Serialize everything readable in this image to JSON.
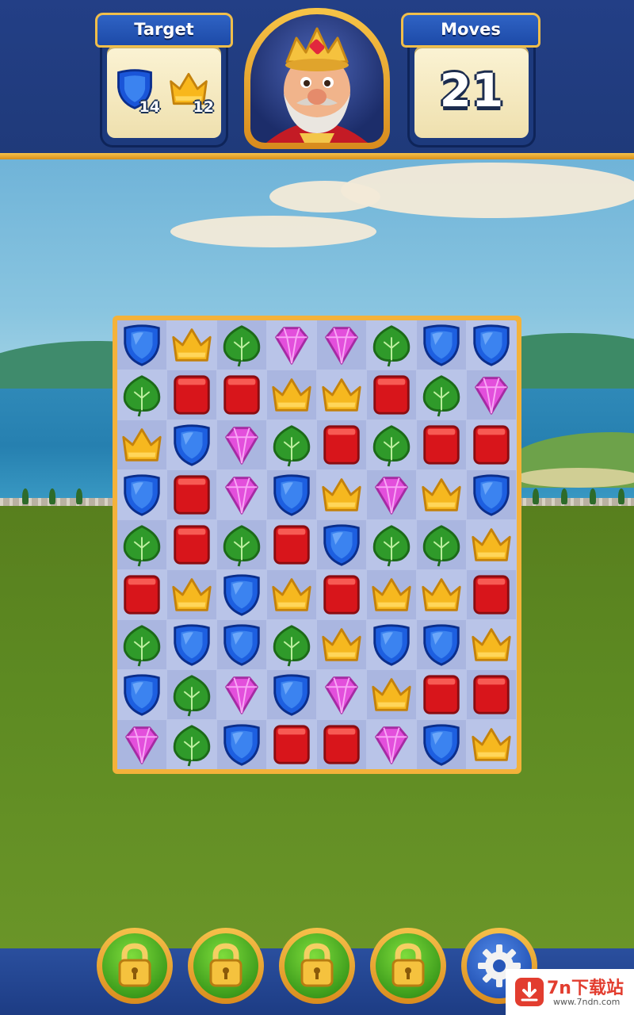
{
  "header": {
    "target_label": "Target",
    "moves_label": "Moves",
    "moves_value": "21",
    "targets": [
      {
        "piece": "shield",
        "count": "14"
      },
      {
        "piece": "crown",
        "count": "12"
      }
    ]
  },
  "board": {
    "rows": 9,
    "cols": 8,
    "grid": [
      [
        "shield",
        "crown",
        "leaf",
        "gem",
        "gem",
        "leaf",
        "shield",
        "shield"
      ],
      [
        "leaf",
        "box",
        "box",
        "crown",
        "crown",
        "box",
        "leaf",
        "gem"
      ],
      [
        "crown",
        "shield",
        "gem",
        "leaf",
        "box",
        "leaf",
        "box",
        "box"
      ],
      [
        "shield",
        "box",
        "gem",
        "shield",
        "crown",
        "gem",
        "crown",
        "shield"
      ],
      [
        "leaf",
        "box",
        "leaf",
        "box",
        "shield",
        "leaf",
        "leaf",
        "crown"
      ],
      [
        "box",
        "crown",
        "shield",
        "crown",
        "box",
        "crown",
        "crown",
        "box"
      ],
      [
        "leaf",
        "shield",
        "shield",
        "leaf",
        "crown",
        "shield",
        "shield",
        "crown"
      ],
      [
        "shield",
        "leaf",
        "gem",
        "shield",
        "gem",
        "crown",
        "box",
        "box"
      ],
      [
        "gem",
        "leaf",
        "shield",
        "box",
        "box",
        "gem",
        "shield",
        "crown"
      ]
    ]
  },
  "boosters": [
    {
      "name": "booster-1",
      "state": "locked",
      "icon": "lock-icon"
    },
    {
      "name": "booster-2",
      "state": "locked",
      "icon": "lock-icon"
    },
    {
      "name": "booster-3",
      "state": "locked",
      "icon": "lock-icon"
    },
    {
      "name": "booster-4",
      "state": "locked",
      "icon": "lock-icon"
    },
    {
      "name": "settings",
      "icon": "gear-icon"
    }
  ],
  "watermark": {
    "text": "7n下载站",
    "url": "www.7ndn.com"
  },
  "colors": {
    "shield": "#1d5fe0",
    "crown": "#f6b81f",
    "leaf": "#2f9a2a",
    "gem": "#e34fdc",
    "box": "#d8151b"
  }
}
